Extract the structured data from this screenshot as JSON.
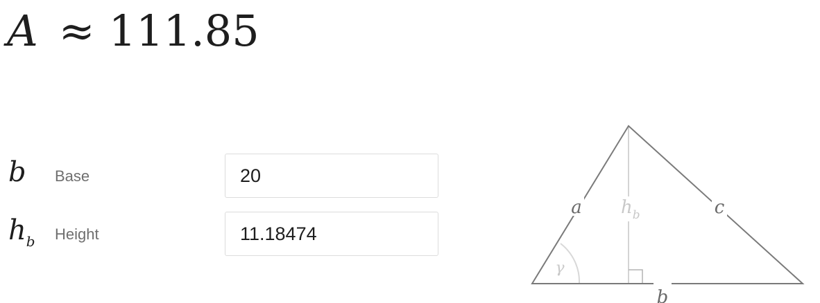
{
  "result": {
    "symbol": "A",
    "approx": "≈",
    "value": "111.85"
  },
  "inputs": {
    "base": {
      "symbol": "b",
      "label": "Base",
      "value": "20"
    },
    "height": {
      "symbol": "h",
      "subscript": "b",
      "label": "Height",
      "value": "11.18474"
    }
  },
  "diagram": {
    "side_a": "a",
    "side_b": "b",
    "side_c": "c",
    "height": "h",
    "height_sub": "b",
    "angle": "γ"
  },
  "colors": {
    "text": "#1e1e1e",
    "label": "#6f6f6f",
    "border": "#dcdcdc",
    "triangle": "#7a7a7a",
    "faint": "#c8c8c8"
  }
}
